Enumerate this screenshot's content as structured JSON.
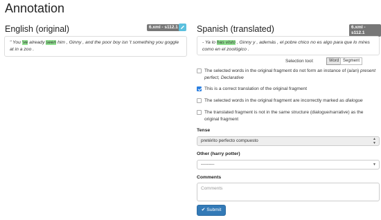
{
  "page": {
    "title": "Annotation"
  },
  "english": {
    "heading": "English (original)",
    "badge": "6.xml - s112.1",
    "fragment": {
      "t1": "\" You ",
      "h1": "'ve",
      "t2": " already ",
      "h2": "seen",
      "t3": " him , Ginny , and the poor boy isn 't something you goggle at in a zoo ."
    }
  },
  "spanish": {
    "heading": "Spanish (translated)",
    "badge": "6.xml - s112.1",
    "fragment": {
      "t1": "- Ya lo ",
      "h1": "has visto",
      "t2": " , Ginny y , además , el pobre chico no es algo para que lo mires como en el zoológico ."
    }
  },
  "selection_tool": {
    "label": "Selection tool:",
    "options": [
      "Word",
      "Segment"
    ],
    "active": "Word"
  },
  "options": [
    {
      "pre": "The selected words in the original fragment do not form an instance of (a/an) ",
      "em": "present perfect, Declarative",
      "checked": false
    },
    {
      "pre": "This is a correct translation of the original fragment",
      "em": "",
      "checked": true
    },
    {
      "pre": "The selected words in the original fragment are incorrectly marked as ",
      "em": "dialogue",
      "checked": false
    },
    {
      "pre": "The translated fragment is not in the same structure (dialogue/narrative) as the original fragment",
      "em": "",
      "checked": false
    }
  ],
  "tense": {
    "label": "Tense",
    "value": "pretérito perfecto compuesto"
  },
  "other": {
    "label": "Other (harry potter)",
    "value": "---------"
  },
  "comments": {
    "label": "Comments",
    "placeholder": "Comments"
  },
  "submit": {
    "label": "Submit"
  }
}
